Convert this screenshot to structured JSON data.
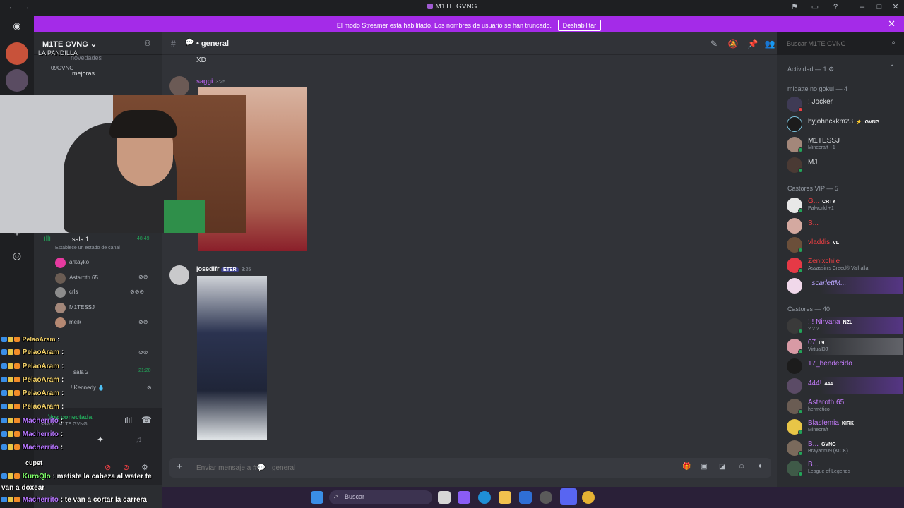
{
  "window": {
    "title": "M1TE GVNG"
  },
  "banner": {
    "message": "El modo Streamer está habilitado. Los nombres de usuario se han truncado.",
    "button_label": "Deshabilitar"
  },
  "server": {
    "name": "M1TE GVNG",
    "folder_label": "LA PANDILLA",
    "channels": [
      "novedades",
      "mejoras"
    ],
    "user_overlay": "09GVNG"
  },
  "voice": {
    "channel_name": "sala 1",
    "channel_time": "48:49",
    "status_prompt": "Establece un estado de canal",
    "members": [
      "arkayko",
      "Astaroth 65",
      "crls",
      "M1TESSJ",
      "meik"
    ],
    "second_channel_time": "21:20",
    "second_channel_name": "sala 2",
    "extra_member": "! Kennedy",
    "connected_label": "Voz conectada",
    "connected_sub": "sala 1 / M1TE GVNG"
  },
  "chat": {
    "channel_name": "general",
    "messages": [
      {
        "author": "",
        "text": "XD"
      },
      {
        "author": "saggi",
        "time": "3:25"
      },
      {
        "author": "josedlfr",
        "badge": "ETER",
        "time": "3:25"
      }
    ],
    "composer_placeholder": "Enviar mensaje a #💬 · general"
  },
  "search": {
    "placeholder": "Buscar M1TE GVNG"
  },
  "members_panel": {
    "activity_label": "Actividad — 1",
    "sections": [
      {
        "title": "migatte no gokui — 4",
        "members": [
          {
            "name": "! Jocker",
            "sub": "",
            "tag": ""
          },
          {
            "name": "byjohnckkm23",
            "sub": "",
            "tag": "GVNG"
          },
          {
            "name": "M1TESSJ",
            "sub": "Minecraft +1",
            "tag": ""
          },
          {
            "name": "MJ",
            "sub": "",
            "tag": ""
          }
        ]
      },
      {
        "title": "Castores VIP — 5",
        "members": [
          {
            "name": "G...",
            "sub": "Palworld +1",
            "tag": "CRTY"
          },
          {
            "name": "S...",
            "sub": "",
            "tag": ""
          },
          {
            "name": "vladdis",
            "sub": "",
            "tag": "VL"
          },
          {
            "name": "Zenixchile",
            "sub": "Assassin's Creed® Valhalla",
            "tag": ""
          },
          {
            "name": "_scarlettM...",
            "sub": "",
            "tag": ""
          }
        ]
      },
      {
        "title": "Castores — 40",
        "members": [
          {
            "name": "! ! Nirvana",
            "sub": "? ? ?",
            "tag": "NZL"
          },
          {
            "name": "07",
            "sub": "VirtualDJ",
            "tag": "L9"
          },
          {
            "name": "17_bendecido",
            "sub": "",
            "tag": ""
          },
          {
            "name": "444!",
            "sub": "",
            "tag": "444"
          },
          {
            "name": "Astaroth 65",
            "sub": "hermético",
            "tag": ""
          },
          {
            "name": "Blasfemia",
            "sub": "Minecraft",
            "tag": "KIRK"
          },
          {
            "name": "B...",
            "sub": "Brayann09 (KICK)",
            "tag": "GVNG"
          },
          {
            "name": "B...",
            "sub": "League of Legends",
            "tag": ""
          }
        ]
      }
    ]
  },
  "stream_chat": [
    {
      "user": "PelaoAram",
      "text": ":"
    },
    {
      "user": "PelaoAram",
      "text": ":"
    },
    {
      "user": "PelaoAram",
      "text": ":"
    },
    {
      "user": "PelaoAram",
      "text": ":"
    },
    {
      "user": "PelaoAram",
      "text": ":"
    },
    {
      "user": "PelaoAram",
      "text": ":"
    },
    {
      "user": "Macherrito",
      "text": ":"
    },
    {
      "user": "Macherrito",
      "text": ":"
    },
    {
      "user": "Macherrito",
      "text": ":"
    },
    {
      "user": "cupet",
      "text": ""
    },
    {
      "user": "KuroQlo",
      "text": ": metiste la cabeza al water te van a doxear"
    },
    {
      "user": "Macherrito",
      "text": ": te van a cortar la carrera"
    }
  ],
  "taskbar": {
    "search_placeholder": "Buscar"
  },
  "colors": {
    "banner": "#a42be8",
    "background": "#313338",
    "sidebar": "#2b2d31",
    "online": "#23a559"
  }
}
